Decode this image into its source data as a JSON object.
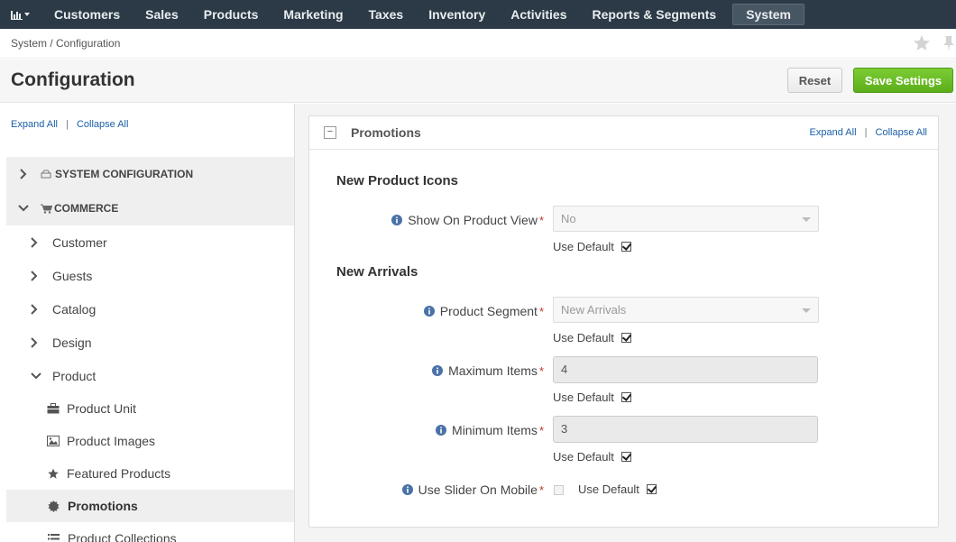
{
  "nav": {
    "items": [
      "Customers",
      "Sales",
      "Products",
      "Marketing",
      "Taxes",
      "Inventory",
      "Activities",
      "Reports & Segments",
      "System"
    ]
  },
  "breadcrumb": "System / Configuration",
  "page": {
    "title": "Configuration",
    "reset_label": "Reset",
    "save_label": "Save Settings"
  },
  "sidebar": {
    "expand_all": "Expand All",
    "collapse_all": "Collapse All",
    "sep": "|",
    "groups": [
      "SYSTEM CONFIGURATION",
      "COMMERCE"
    ],
    "items": [
      "Customer",
      "Guests",
      "Catalog",
      "Design",
      "Product"
    ],
    "leaves": [
      "Product Unit",
      "Product Images",
      "Featured Products",
      "Promotions",
      "Product Collections"
    ]
  },
  "panel": {
    "title": "Promotions",
    "expand_all": "Expand All",
    "collapse_all": "Collapse All",
    "sep": "|",
    "collapse_symbol": "−",
    "sections": {
      "new_product_icons": "New Product Icons",
      "new_arrivals": "New Arrivals"
    },
    "fields": {
      "show_on_product_view": {
        "label": "Show On Product View",
        "value": "No"
      },
      "product_segment": {
        "label": "Product Segment",
        "value": "New Arrivals"
      },
      "maximum_items": {
        "label": "Maximum Items",
        "value": "4"
      },
      "minimum_items": {
        "label": "Minimum Items",
        "value": "3"
      },
      "use_slider_on_mobile": {
        "label": "Use Slider On Mobile"
      }
    },
    "use_default_label": "Use Default",
    "required_mark": "*"
  }
}
